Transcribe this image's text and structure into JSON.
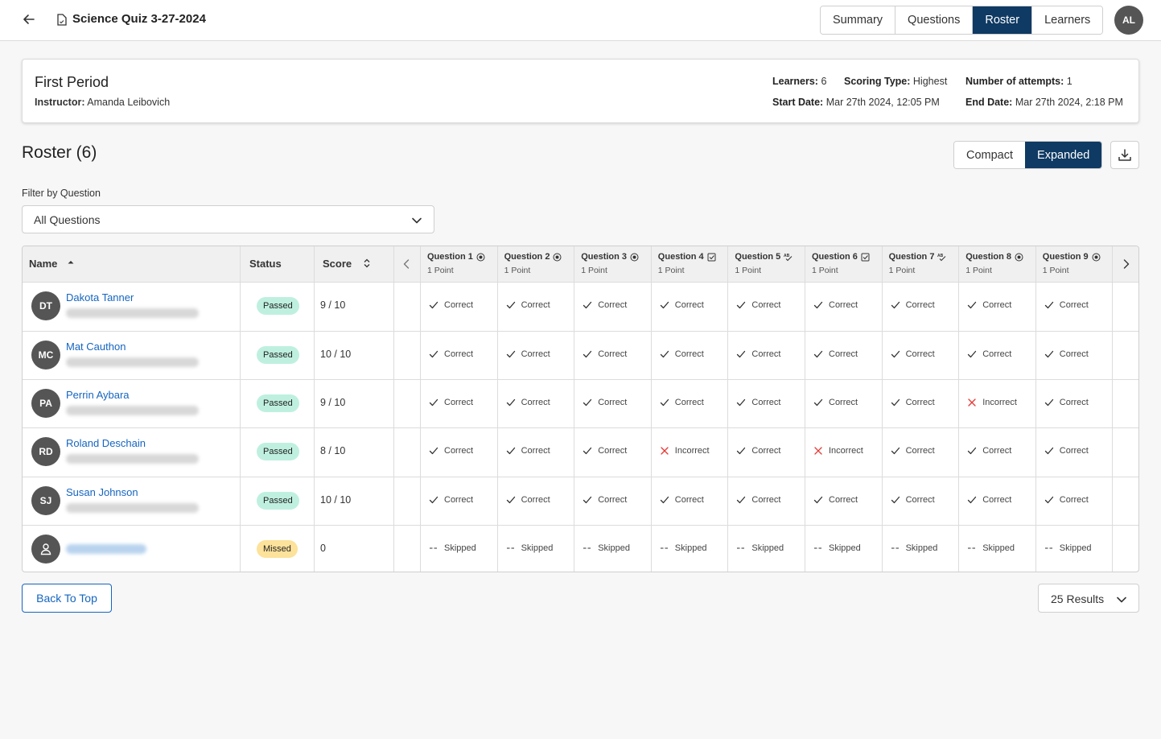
{
  "header": {
    "quiz_title": "Science Quiz 3-27-2024",
    "tabs": [
      {
        "label": "Summary",
        "active": false
      },
      {
        "label": "Questions",
        "active": false
      },
      {
        "label": "Roster",
        "active": true
      },
      {
        "label": "Learners",
        "active": false
      }
    ],
    "user_initials": "AL"
  },
  "info": {
    "period": "First Period",
    "instructor_label": "Instructor:",
    "instructor": "Amanda Leibovich",
    "learners_label": "Learners:",
    "learners": "6",
    "scoring_label": "Scoring Type:",
    "scoring": "Highest",
    "attempts_label": "Number of attempts:",
    "attempts": "1",
    "start_label": "Start Date:",
    "start": "Mar 27th 2024, 12:05 PM",
    "end_label": "End Date:",
    "end": "Mar 27th 2024, 2:18 PM"
  },
  "roster": {
    "title": "Roster (6)",
    "view_compact": "Compact",
    "view_expanded": "Expanded",
    "filter_label": "Filter by Question",
    "filter_value": "All Questions"
  },
  "table": {
    "col_name": "Name",
    "col_status": "Status",
    "col_score": "Score",
    "questions": [
      {
        "title": "Question 1",
        "points": "1 Point",
        "type_icon": "radio-icon"
      },
      {
        "title": "Question 2",
        "points": "1 Point",
        "type_icon": "radio-icon"
      },
      {
        "title": "Question 3",
        "points": "1 Point",
        "type_icon": "radio-icon"
      },
      {
        "title": "Question 4",
        "points": "1 Point",
        "type_icon": "checkbox-icon"
      },
      {
        "title": "Question 5",
        "points": "1 Point",
        "type_icon": "spellcheck-icon"
      },
      {
        "title": "Question 6",
        "points": "1 Point",
        "type_icon": "checkbox-icon"
      },
      {
        "title": "Question 7",
        "points": "1 Point",
        "type_icon": "spellcheck-icon"
      },
      {
        "title": "Question 8",
        "points": "1 Point",
        "type_icon": "radio-icon"
      },
      {
        "title": "Question 9",
        "points": "1 Point",
        "type_icon": "radio-icon"
      }
    ],
    "rows": [
      {
        "initials": "DT",
        "name": "Dakota Tanner",
        "status": "Passed",
        "score": "9 / 10",
        "answers": [
          "Correct",
          "Correct",
          "Correct",
          "Correct",
          "Correct",
          "Correct",
          "Correct",
          "Correct",
          "Correct"
        ]
      },
      {
        "initials": "MC",
        "name": "Mat Cauthon",
        "status": "Passed",
        "score": "10 / 10",
        "answers": [
          "Correct",
          "Correct",
          "Correct",
          "Correct",
          "Correct",
          "Correct",
          "Correct",
          "Correct",
          "Correct"
        ]
      },
      {
        "initials": "PA",
        "name": "Perrin Aybara",
        "status": "Passed",
        "score": "9 / 10",
        "answers": [
          "Correct",
          "Correct",
          "Correct",
          "Correct",
          "Correct",
          "Correct",
          "Correct",
          "Incorrect",
          "Correct"
        ]
      },
      {
        "initials": "RD",
        "name": "Roland Deschain",
        "status": "Passed",
        "score": "8 / 10",
        "answers": [
          "Correct",
          "Correct",
          "Correct",
          "Incorrect",
          "Correct",
          "Incorrect",
          "Correct",
          "Correct",
          "Correct"
        ]
      },
      {
        "initials": "SJ",
        "name": "Susan Johnson",
        "status": "Passed",
        "score": "10 / 10",
        "answers": [
          "Correct",
          "Correct",
          "Correct",
          "Correct",
          "Correct",
          "Correct",
          "Correct",
          "Correct",
          "Correct"
        ]
      },
      {
        "initials": "",
        "name": "",
        "status": "Missed",
        "score": "0",
        "answers": [
          "Skipped",
          "Skipped",
          "Skipped",
          "Skipped",
          "Skipped",
          "Skipped",
          "Skipped",
          "Skipped",
          "Skipped"
        ]
      }
    ]
  },
  "footer": {
    "back_to_top": "Back To Top",
    "results": "25 Results"
  },
  "colors": {
    "primary": "#0f3a63",
    "link": "#1565c0",
    "passed": "#bff0df",
    "missed": "#fce29a",
    "incorrect": "#e53935"
  }
}
